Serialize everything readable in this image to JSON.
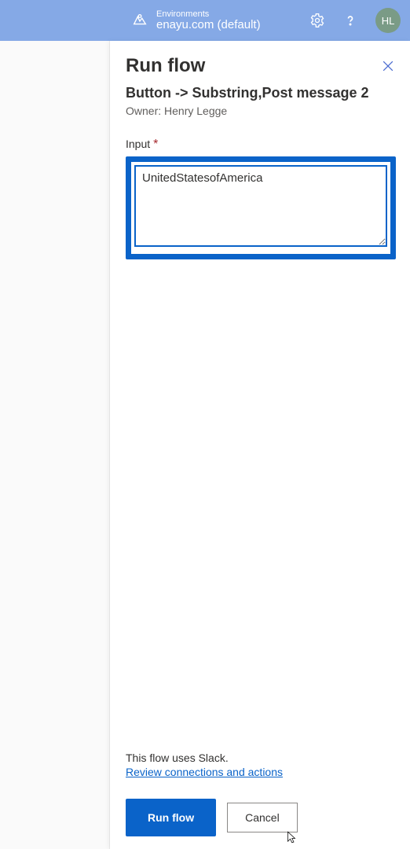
{
  "header": {
    "env_label": "Environments",
    "env_name": "enayu.com (default)",
    "avatar_initials": "HL"
  },
  "panel": {
    "title": "Run flow",
    "subtitle": "Button -> Substring,Post message 2",
    "owner": "Owner: Henry Legge",
    "input_label": "Input",
    "input_value": "UnitedStatesofAmerica",
    "footer_note": "This flow uses Slack.",
    "review_link": "Review connections and actions",
    "run_button": "Run flow",
    "cancel_button": "Cancel"
  }
}
